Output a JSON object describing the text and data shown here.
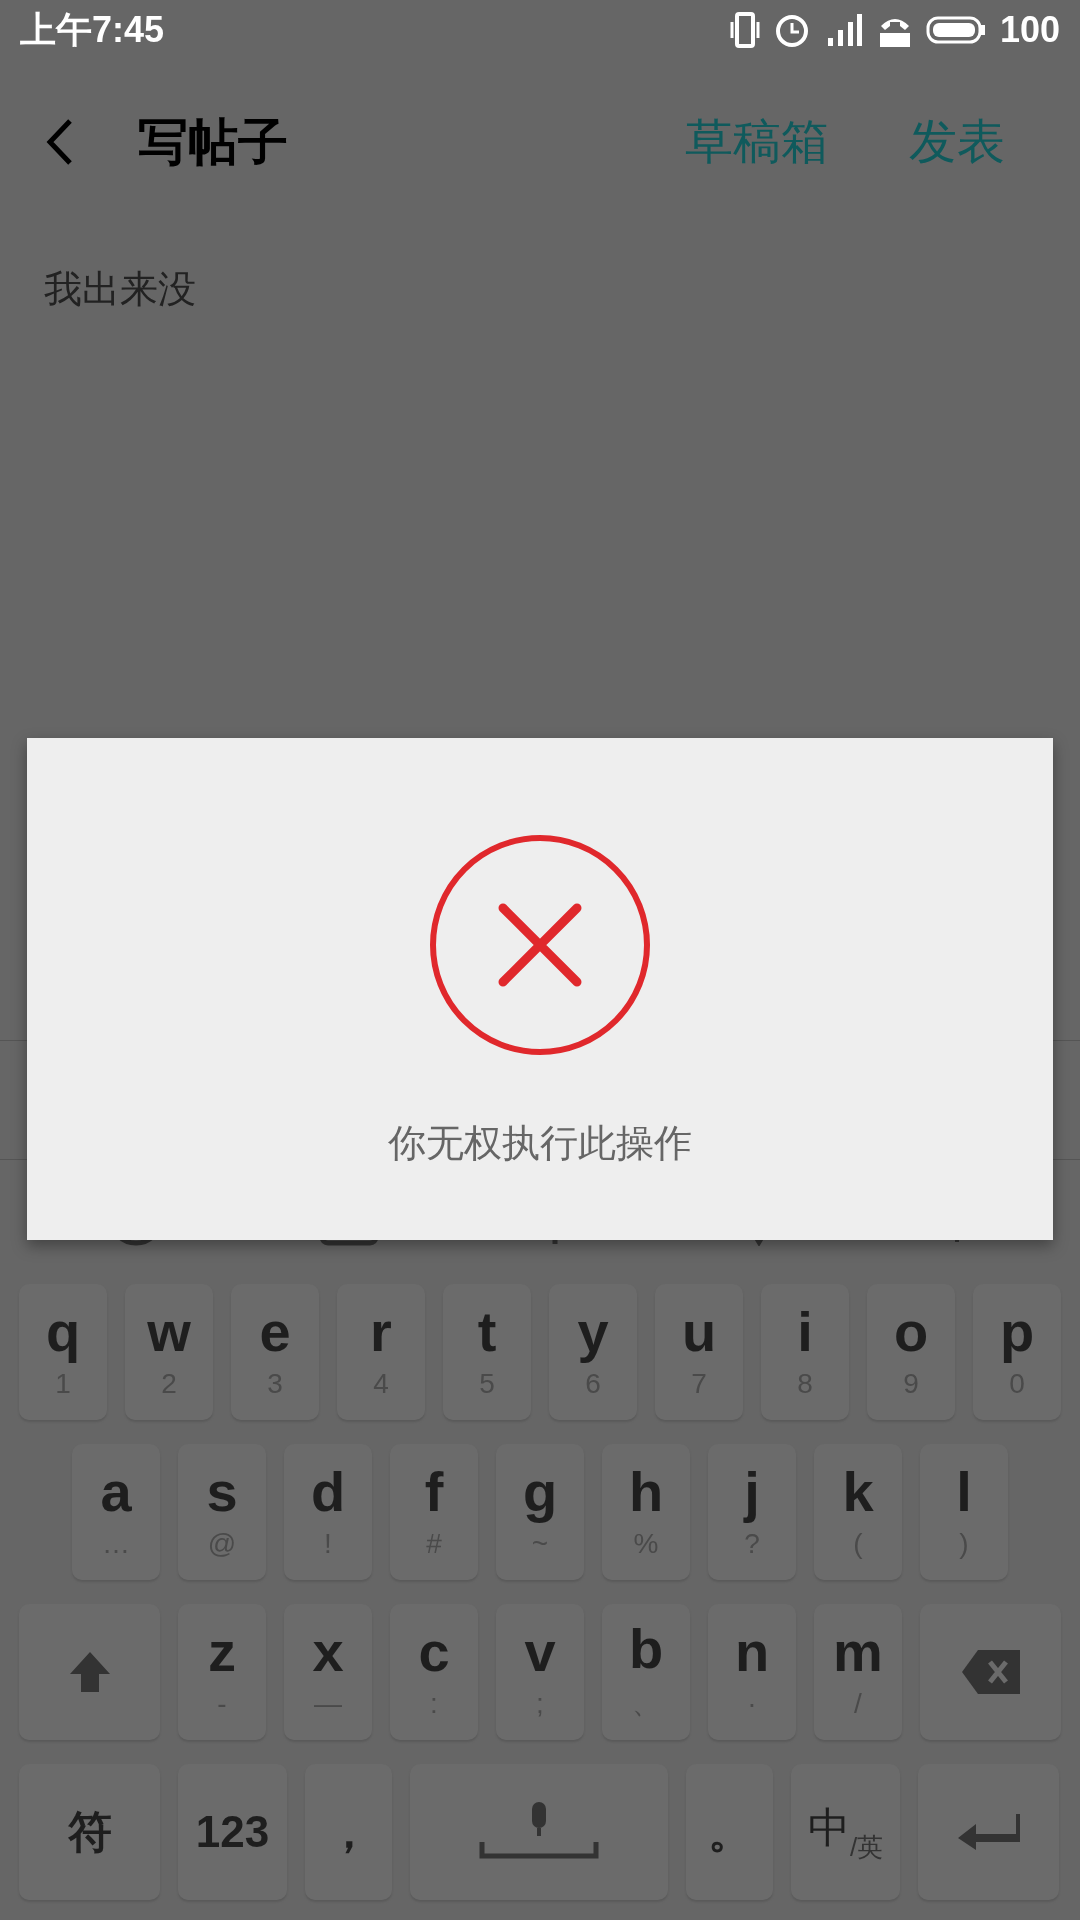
{
  "status_bar": {
    "time": "上午7:45",
    "battery": "100"
  },
  "header": {
    "title": "写帖子",
    "actions": [
      "草稿箱",
      "发表"
    ]
  },
  "editor": {
    "value": "我出来没"
  },
  "dialog": {
    "message": "你无权执行此操作"
  },
  "keyboard": {
    "rows": [
      {
        "keys": [
          {
            "kind": "letter",
            "main": "q",
            "sub": "1"
          },
          {
            "kind": "letter",
            "main": "w",
            "sub": "2"
          },
          {
            "kind": "letter",
            "main": "e",
            "sub": "3"
          },
          {
            "kind": "letter",
            "main": "r",
            "sub": "4"
          },
          {
            "kind": "letter",
            "main": "t",
            "sub": "5"
          },
          {
            "kind": "letter",
            "main": "y",
            "sub": "6"
          },
          {
            "kind": "letter",
            "main": "u",
            "sub": "7"
          },
          {
            "kind": "letter",
            "main": "i",
            "sub": "8"
          },
          {
            "kind": "letter",
            "main": "o",
            "sub": "9"
          },
          {
            "kind": "letter",
            "main": "p",
            "sub": "0"
          }
        ]
      },
      {
        "keys": [
          {
            "kind": "letter",
            "main": "a",
            "sub": "…"
          },
          {
            "kind": "letter",
            "main": "s",
            "sub": "@"
          },
          {
            "kind": "letter",
            "main": "d",
            "sub": "!"
          },
          {
            "kind": "letter",
            "main": "f",
            "sub": "#"
          },
          {
            "kind": "letter",
            "main": "g",
            "sub": "~"
          },
          {
            "kind": "letter",
            "main": "h",
            "sub": "%"
          },
          {
            "kind": "letter",
            "main": "j",
            "sub": "?"
          },
          {
            "kind": "letter",
            "main": "k",
            "sub": "("
          },
          {
            "kind": "letter",
            "main": "l",
            "sub": ")"
          }
        ]
      },
      {
        "keys": [
          {
            "kind": "shift"
          },
          {
            "kind": "letter",
            "main": "z",
            "sub": "-"
          },
          {
            "kind": "letter",
            "main": "x",
            "sub": "—"
          },
          {
            "kind": "letter",
            "main": "c",
            "sub": ":"
          },
          {
            "kind": "letter",
            "main": "v",
            "sub": ";"
          },
          {
            "kind": "letter",
            "main": "b",
            "sub": "、"
          },
          {
            "kind": "letter",
            "main": "n",
            "sub": "·"
          },
          {
            "kind": "letter",
            "main": "m",
            "sub": "/"
          },
          {
            "kind": "backspace"
          }
        ]
      },
      {
        "keys": [
          {
            "kind": "text",
            "main": "符"
          },
          {
            "kind": "text",
            "main": "123"
          },
          {
            "kind": "text",
            "main": "，"
          },
          {
            "kind": "space"
          },
          {
            "kind": "text",
            "main": "。"
          },
          {
            "kind": "lang",
            "main": "中",
            "sub": "/英"
          },
          {
            "kind": "enter"
          }
        ]
      }
    ]
  }
}
